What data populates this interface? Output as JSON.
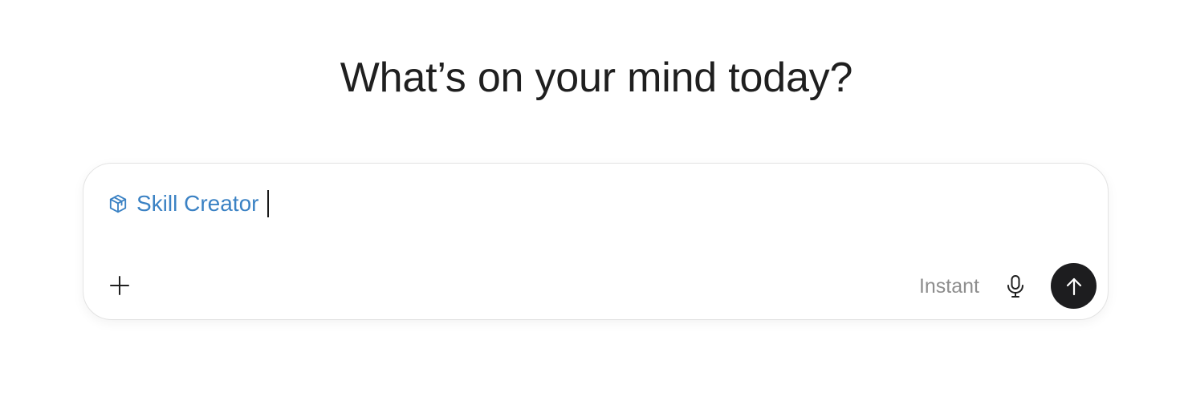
{
  "heading": "What’s on your mind today?",
  "composer": {
    "skill_chip_label": "Skill Creator",
    "skill_chip_icon": "cube-icon",
    "skill_chip_color": "#3b82c4",
    "input_value": "",
    "attach_icon": "plus-icon",
    "mode_label": "Instant",
    "mic_icon": "microphone-icon",
    "send_icon": "arrow-up-icon",
    "send_button_color": "#1d1d1f"
  }
}
